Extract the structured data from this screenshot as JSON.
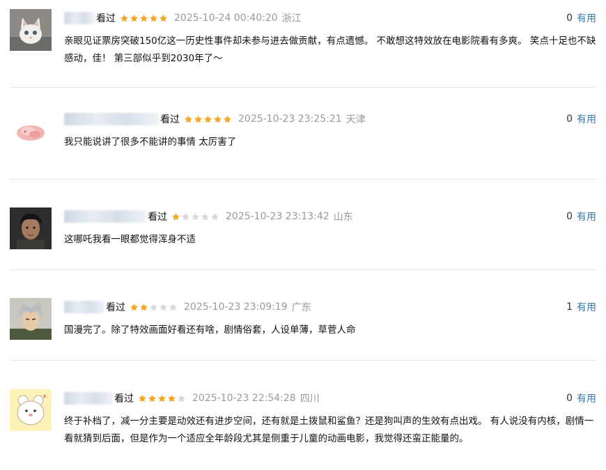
{
  "colors": {
    "accent_link": "#3377aa",
    "star_on": "#f5a623",
    "star_off": "#d8d8d8",
    "muted": "#999999"
  },
  "comments": [
    {
      "avatar_icon": "white-kitten-avatar",
      "watched_label": "看过",
      "rating": 5,
      "time": "2025-10-24 00:40:20",
      "region": "浙江",
      "useful_count": "0",
      "useful_label": "有用",
      "text": "亲眼见证票房突破150亿这一历史性事件却未参与进去做贡献，有点遗憾。 不敢想这特效放在电影院看有多爽。 笑点十足也不缺感动，佳！ 第三部似乎到2030年了～"
    },
    {
      "avatar_icon": "pink-blob-avatar",
      "watched_label": "看过",
      "rating": 5,
      "time": "2025-10-23 23:25:21",
      "region": "天津",
      "useful_count": "0",
      "useful_label": "有用",
      "text": "我只能说讲了很多不能讲的事情 太厉害了"
    },
    {
      "avatar_icon": "dark-haired-person-avatar",
      "watched_label": "看过",
      "rating": 1,
      "time": "2025-10-23 23:13:42",
      "region": "山东",
      "useful_count": "0",
      "useful_label": "有用",
      "text": "这哪吒我看一眼都觉得浑身不适"
    },
    {
      "avatar_icon": "anime-gray-hair-character-avatar",
      "watched_label": "看过",
      "rating": 2,
      "time": "2025-10-23 23:09:19",
      "region": "广东",
      "useful_count": "1",
      "useful_label": "有用",
      "text": "国漫完了。除了特效画面好看还有啥，剧情俗套，人设单薄，草菅人命"
    },
    {
      "avatar_icon": "cartoon-white-bear-avatar",
      "watched_label": "看过",
      "rating": 4,
      "time": "2025-10-23 22:54:28",
      "region": "四川",
      "useful_count": "0",
      "useful_label": "有用",
      "text": "终于补档了，减一分主要是动效还有进步空间，还有就是土拨鼠和鲨鱼？还是狗叫声的生效有点出戏。 有人说没有内核，剧情一看就猜到后面，但是作为一个适应全年龄段尤其是侧重于儿童的动画电影，我觉得还蛮正能量的。"
    }
  ]
}
